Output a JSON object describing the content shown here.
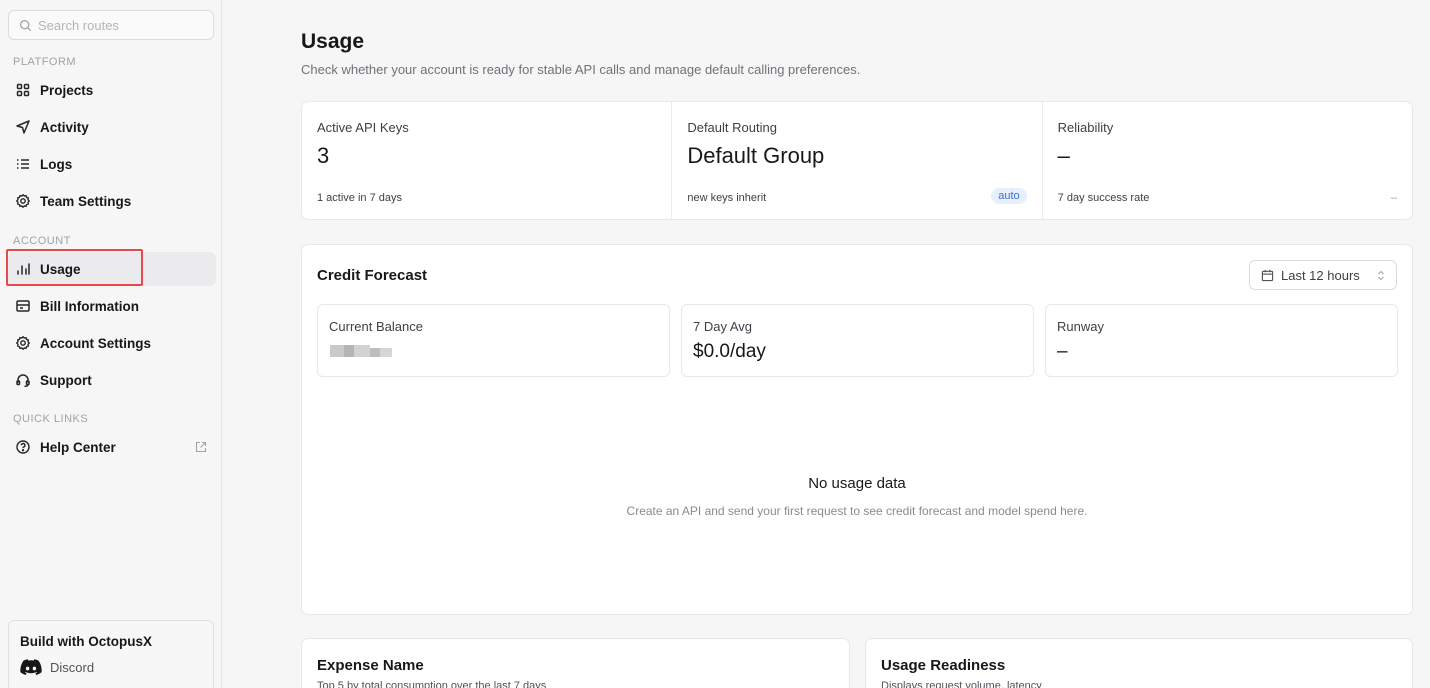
{
  "sidebar": {
    "search_placeholder": "Search routes",
    "sections": {
      "platform": "PLATFORM",
      "account": "ACCOUNT",
      "quick_links": "QUICK LINKS"
    },
    "platform_items": [
      {
        "label": "Projects",
        "icon": "grid-icon"
      },
      {
        "label": "Activity",
        "icon": "send-icon"
      },
      {
        "label": "Logs",
        "icon": "list-icon"
      },
      {
        "label": "Team Settings",
        "icon": "gear-icon"
      }
    ],
    "account_items": [
      {
        "label": "Usage",
        "icon": "bar-chart-icon",
        "active": true
      },
      {
        "label": "Bill Information",
        "icon": "receipt-icon"
      },
      {
        "label": "Account Settings",
        "icon": "gear-icon"
      },
      {
        "label": "Support",
        "icon": "headset-icon"
      }
    ],
    "quick_links": [
      {
        "label": "Help Center",
        "icon": "help-circle-icon",
        "external": true
      }
    ],
    "build_card": {
      "title": "Build with OctopusX",
      "discord_label": "Discord"
    }
  },
  "main": {
    "title": "Usage",
    "subtitle": "Check whether your account is ready for stable API calls and manage default calling preferences.",
    "stats": [
      {
        "label": "Active API Keys",
        "value": "3",
        "foot": "1 active in 7 days"
      },
      {
        "label": "Default Routing",
        "value": "Default Group",
        "foot": "new keys inherit",
        "badge": "auto"
      },
      {
        "label": "Reliability",
        "value": "–",
        "foot": "7 day success rate",
        "foot_right": "–"
      }
    ],
    "forecast": {
      "title": "Credit Forecast",
      "range": "Last 12 hours",
      "cards": [
        {
          "label": "Current Balance",
          "value_hidden": true
        },
        {
          "label": "7 Day Avg",
          "value": "$0.0/day"
        },
        {
          "label": "Runway",
          "value": "–"
        }
      ],
      "empty_title": "No usage data",
      "empty_subtitle": "Create an API and send your first request to see credit forecast and model spend here."
    },
    "bottom_cards": [
      {
        "title": "Expense Name",
        "subtitle": "Top 5 by total consumption over the last 7 days"
      },
      {
        "title": "Usage Readiness",
        "subtitle": "Displays request volume, latency"
      }
    ]
  },
  "colors": {
    "accent_highlight": "#e5484d",
    "badge_text": "#3b6fd4",
    "badge_bg": "#e7eefc"
  }
}
